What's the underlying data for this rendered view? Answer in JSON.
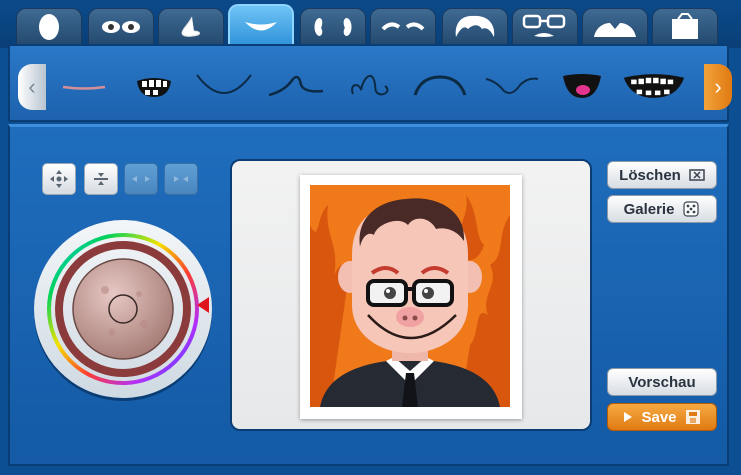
{
  "tabs": [
    {
      "name": "head-shape-icon"
    },
    {
      "name": "eyes-icon"
    },
    {
      "name": "nose-icon"
    },
    {
      "name": "mouth-icon",
      "active": true
    },
    {
      "name": "ears-icon"
    },
    {
      "name": "eyebrows-icon"
    },
    {
      "name": "hair-icon"
    },
    {
      "name": "glasses-mustache-icon"
    },
    {
      "name": "clothes-icon"
    },
    {
      "name": "background-icon"
    }
  ],
  "parts": [
    "mouth-line-icon",
    "mouth-teeth-icon",
    "mouth-smile-curve-icon",
    "mouth-mustache-curve-icon",
    "mouth-nose-swirl-icon",
    "mouth-frown-icon",
    "mouth-wave-icon",
    "mouth-tongue-icon",
    "mouth-grin-teeth-icon"
  ],
  "buttons": {
    "delete": "Löschen",
    "gallery": "Galerie",
    "preview": "Vorschau",
    "save": "Save"
  },
  "colors": {
    "accent": "#2b8fd8",
    "save": "#e07a12",
    "background_orange": "#f07a1a"
  }
}
